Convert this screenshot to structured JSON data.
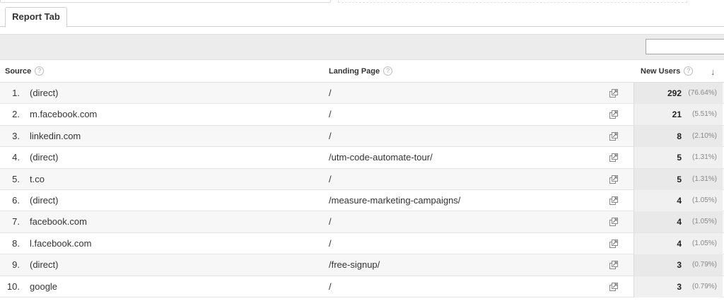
{
  "tab": {
    "label": "Report Tab"
  },
  "filter": {
    "value": ""
  },
  "columns": {
    "source": "Source",
    "landing_page": "Landing Page",
    "new_users": "New Users",
    "help_glyph": "?",
    "sort_glyph": "↓"
  },
  "rows": [
    {
      "num": "1.",
      "source": "(direct)",
      "page": "/",
      "users": "292",
      "pct": "(76.64%)"
    },
    {
      "num": "2.",
      "source": "m.facebook.com",
      "page": "/",
      "users": "21",
      "pct": "(5.51%)"
    },
    {
      "num": "3.",
      "source": "linkedin.com",
      "page": "/",
      "users": "8",
      "pct": "(2.10%)"
    },
    {
      "num": "4.",
      "source": "(direct)",
      "page": "/utm-code-automate-tour/",
      "users": "5",
      "pct": "(1.31%)"
    },
    {
      "num": "5.",
      "source": "t.co",
      "page": "/",
      "users": "5",
      "pct": "(1.31%)"
    },
    {
      "num": "6.",
      "source": "(direct)",
      "page": "/measure-marketing-campaigns/",
      "users": "4",
      "pct": "(1.05%)"
    },
    {
      "num": "7.",
      "source": "facebook.com",
      "page": "/",
      "users": "4",
      "pct": "(1.05%)"
    },
    {
      "num": "8.",
      "source": "l.facebook.com",
      "page": "/",
      "users": "4",
      "pct": "(1.05%)"
    },
    {
      "num": "9.",
      "source": "(direct)",
      "page": "/free-signup/",
      "users": "3",
      "pct": "(0.79%)"
    },
    {
      "num": "10.",
      "source": "google",
      "page": "/",
      "users": "3",
      "pct": "(0.79%)"
    }
  ]
}
